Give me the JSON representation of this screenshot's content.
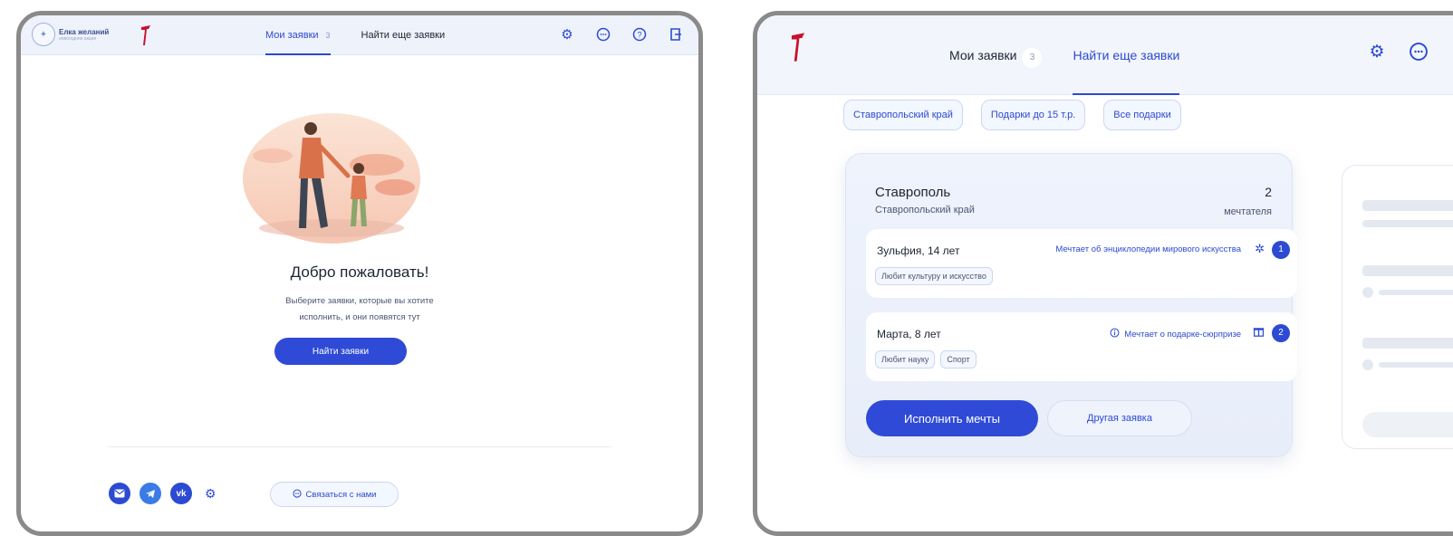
{
  "screen_left": {
    "logo": {
      "title": "Елка желаний",
      "subtitle": "новогодняя акция"
    },
    "tabs": [
      {
        "label": "Мои заявки",
        "count": "3"
      },
      {
        "label": "Найти еще заявки"
      }
    ],
    "welcome": {
      "title": "Добро пожаловать!",
      "line1": "Выберите заявки, которые вы хотите",
      "line2": "исполнить, и они появятся тут",
      "button": "Найти заявки"
    },
    "footer": {
      "contact_button": "Связаться с нами"
    }
  },
  "screen_right": {
    "tabs": [
      {
        "label": "Мои заявки",
        "count": "3"
      },
      {
        "label": "Найти еще заявки"
      }
    ],
    "filters": [
      "Ставропольский край",
      "Подарки до 15 т.р.",
      "Все подарки"
    ],
    "card": {
      "city": "Ставрополь",
      "region": "Ставропольский край",
      "dreamers_count": "2",
      "dreamers_label": "мечтателя",
      "children": [
        {
          "name": "Зульфия, 14 лет",
          "dream": "Мечтает об энциклопедии мирового искусства",
          "number": "1",
          "tags": [
            "Любит культуру и искусство"
          ]
        },
        {
          "name": "Марта, 8 лет",
          "dream": "Мечтает о подарке-сюрпризе",
          "number": "2",
          "tags": [
            "Любит науку",
            "Спорт"
          ]
        }
      ],
      "primary_button": "Исполнить мечты",
      "secondary_button": "Другая заявка"
    }
  },
  "colors": {
    "accent": "#2c4ad2",
    "header_bg": "#eef2fb",
    "frame": "#8a8a8a"
  }
}
